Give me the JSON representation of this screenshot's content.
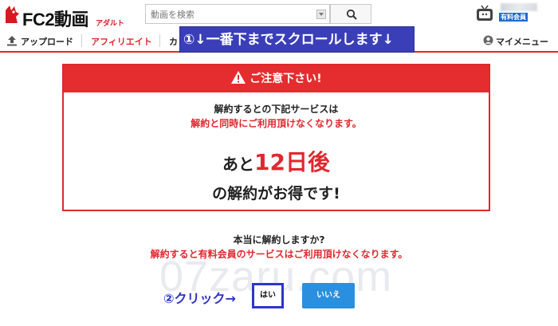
{
  "header": {
    "logo_text": "FC2動画",
    "logo_sub": "アダルト",
    "search_placeholder": "動画を検索",
    "member_badge": "有料会員"
  },
  "nav": {
    "upload": "アップロード",
    "affiliate": "アフィリエイト",
    "cut": "カ",
    "mymenu": "マイメニュー"
  },
  "annotations": {
    "step1": "①↓一番下までスクロールします↓",
    "step2": "②クリック→"
  },
  "notice": {
    "title": "ご注意下さい!",
    "line1": "解約するとの下記サービスは",
    "line2": "解約と同時にご利用頂けなくなります。",
    "countdown_pre": "あと",
    "countdown_num": "12日後",
    "final": "の解約がお得です!"
  },
  "confirm": {
    "question": "本当に解約しますか?",
    "warning": "解約すると有料会員のサービスはご利用頂けなくなります。",
    "yes_label": "はい",
    "no_label": "いいえ"
  },
  "watermark": "07zaru.com",
  "colors": {
    "accent_red": "#e0282f",
    "no_button_blue": "#2b8fe0",
    "annotation_blue": "#3a3fb8"
  }
}
